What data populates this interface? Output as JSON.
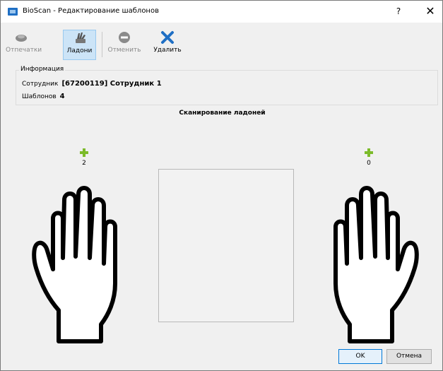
{
  "window": {
    "title": "BioScan - Редактирование шаблонов",
    "help_label": "?",
    "close_label": "✕"
  },
  "toolbar": {
    "fingerprints_label": "Отпечатки",
    "palms_label": "Ладони",
    "cancel_label": "Отменить",
    "delete_label": "Удалить"
  },
  "info": {
    "group_title": "Информация",
    "employee_label": "Сотрудник",
    "employee_value": "[67200119] Сотрудник 1",
    "templates_label": "Шаблонов",
    "templates_value": "4"
  },
  "scan": {
    "title": "Сканирование ладоней",
    "left_count": "2",
    "right_count": "0"
  },
  "buttons": {
    "ok_label": "OK",
    "cancel_label": "Отмена"
  },
  "colors": {
    "accent": "#0078d7",
    "plus": "#7cbb2a",
    "delete": "#1f6fc4"
  }
}
